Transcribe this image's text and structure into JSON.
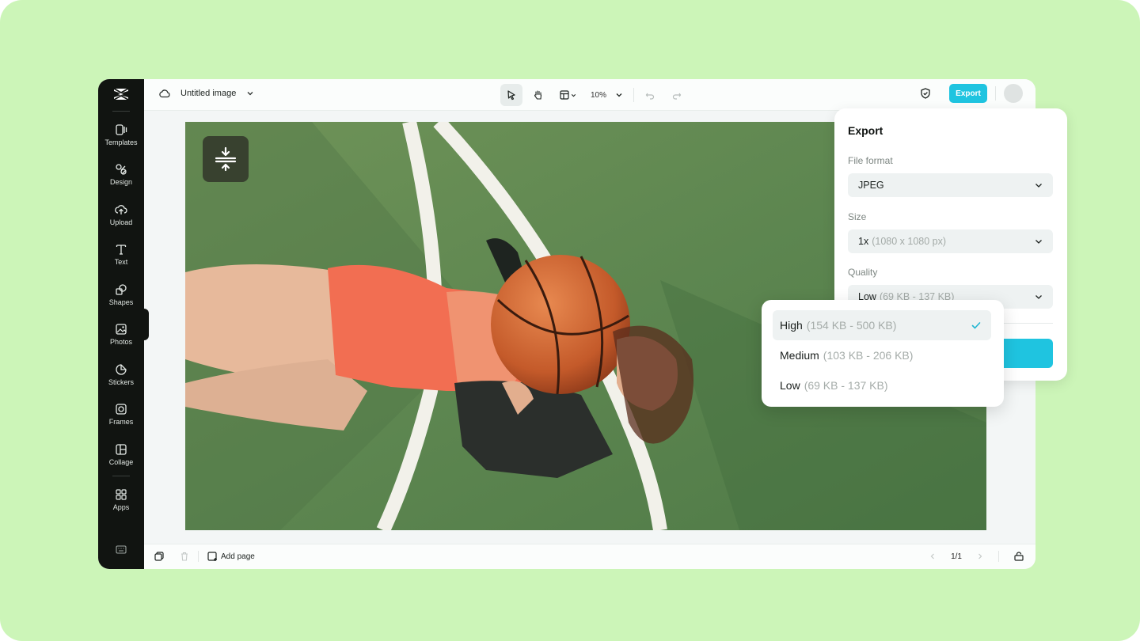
{
  "colors": {
    "background": "#ccf5b8",
    "sidebar": "#111411",
    "accent": "#1fc4e0"
  },
  "sidebar": {
    "logo": "capcut-logo-icon",
    "items": [
      {
        "label": "Templates",
        "icon": "templates-icon"
      },
      {
        "label": "Design",
        "icon": "design-icon"
      },
      {
        "label": "Upload",
        "icon": "upload-icon"
      },
      {
        "label": "Text",
        "icon": "text-icon"
      },
      {
        "label": "Shapes",
        "icon": "shapes-icon"
      },
      {
        "label": "Photos",
        "icon": "photos-icon"
      },
      {
        "label": "Stickers",
        "icon": "stickers-icon"
      },
      {
        "label": "Frames",
        "icon": "frames-icon"
      },
      {
        "label": "Collage",
        "icon": "collage-icon"
      },
      {
        "label": "Apps",
        "icon": "apps-icon"
      }
    ],
    "bottom_icon": "keyboard-icon"
  },
  "header": {
    "title": "Untitled image",
    "zoom": "10%",
    "export_label": "Export"
  },
  "footer": {
    "add_page_label": "Add page",
    "page_indicator": "1/1"
  },
  "export_panel": {
    "title": "Export",
    "file_format_label": "File format",
    "file_format_value": "JPEG",
    "size_label": "Size",
    "size_value": "1x",
    "size_detail": "(1080 x 1080 px)",
    "quality_label": "Quality",
    "quality_value": "Low",
    "quality_detail": "(69 KB - 137 KB)"
  },
  "quality_options": [
    {
      "label": "High",
      "range": "(154 KB - 500 KB)",
      "selected": true
    },
    {
      "label": "Medium",
      "range": "(103 KB - 206 KB)",
      "selected": false
    },
    {
      "label": "Low",
      "range": "(69 KB - 137 KB)",
      "selected": false
    }
  ]
}
